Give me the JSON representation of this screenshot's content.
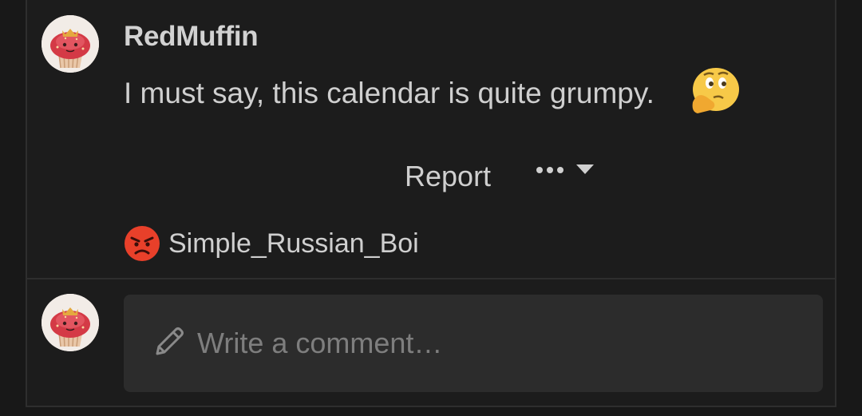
{
  "comment": {
    "author": "RedMuffin",
    "text": "I must say, this calendar is quite grumpy.",
    "emoji_icon": "thinking-face-icon"
  },
  "actions": {
    "report_label": "Report",
    "more_icon": "more-icon",
    "dropdown_icon": "chevron-down-icon"
  },
  "reaction": {
    "icon": "angry-face-icon",
    "user": "Simple_Russian_Boi"
  },
  "composer": {
    "placeholder": "Write a comment…",
    "icon": "pencil-icon"
  },
  "colors": {
    "background": "#181818",
    "panel": "#1c1c1c",
    "input_bg": "#2c2c2c",
    "angry": "#e8402a",
    "thinking": "#f7c948"
  }
}
